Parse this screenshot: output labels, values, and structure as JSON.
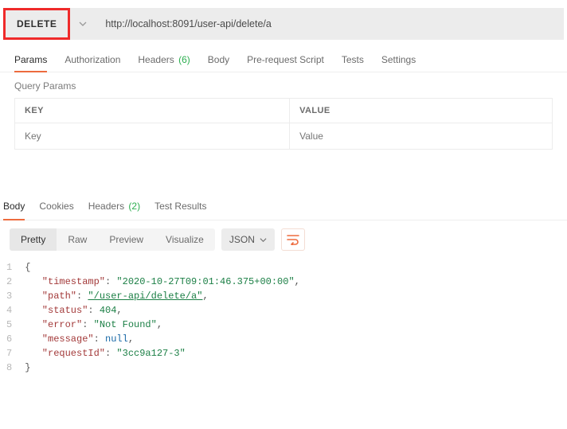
{
  "request": {
    "method": "DELETE",
    "url": "http://localhost:8091/user-api/delete/a"
  },
  "req_tabs": {
    "params": "Params",
    "authorization": "Authorization",
    "headers": "Headers",
    "headers_count": "(6)",
    "body": "Body",
    "prerequest": "Pre-request Script",
    "tests": "Tests",
    "settings": "Settings"
  },
  "query_params": {
    "label": "Query Params",
    "key_header": "KEY",
    "value_header": "VALUE",
    "key_placeholder": "Key",
    "value_placeholder": "Value"
  },
  "resp_tabs": {
    "body": "Body",
    "cookies": "Cookies",
    "headers": "Headers",
    "headers_count": "(2)",
    "test_results": "Test Results"
  },
  "view": {
    "pretty": "Pretty",
    "raw": "Raw",
    "preview": "Preview",
    "visualize": "Visualize",
    "format": "JSON"
  },
  "response_json": {
    "keys": {
      "timestamp": "\"timestamp\"",
      "path": "\"path\"",
      "status": "\"status\"",
      "error": "\"error\"",
      "message": "\"message\"",
      "requestId": "\"requestId\""
    },
    "values": {
      "timestamp": "\"2020-10-27T09:01:46.375+00:00\"",
      "path": "\"/user-api/delete/a\"",
      "status": "404",
      "error": "\"Not Found\"",
      "message": "null",
      "requestId": "\"3cc9a127-3\""
    }
  }
}
